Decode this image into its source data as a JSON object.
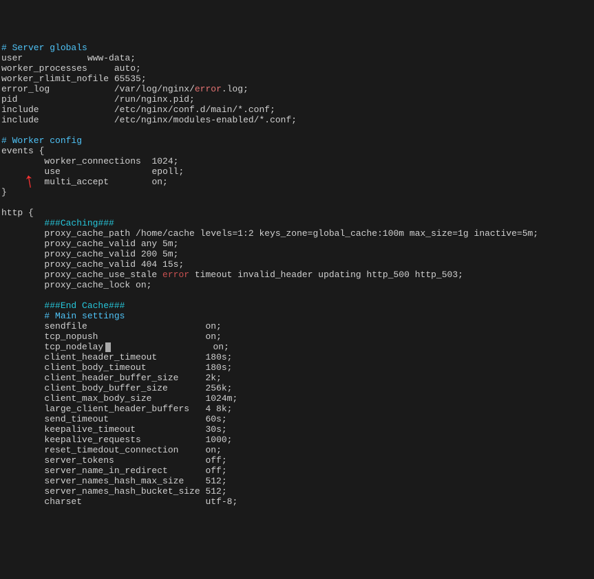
{
  "comments": {
    "server_globals": "# Server globals",
    "worker_config": "# Worker config",
    "caching_start": "###Caching###",
    "caching_end": "###End Cache###",
    "main_settings": "# Main settings"
  },
  "keywords": {
    "error1": "error",
    "error2": "error"
  },
  "globals": [
    {
      "key": "user",
      "pad": "           ",
      "value": " www-data;"
    },
    {
      "key": "worker_processes",
      "pad": "    ",
      "value": " auto;"
    },
    {
      "key": "worker_rlimit_nofile",
      "pad": "",
      "value": " 65535;"
    }
  ],
  "error_log": {
    "key": "error_log",
    "pad": "           ",
    "path_prefix": " /var/log/nginx/",
    "path_suffix": ".log;"
  },
  "globals2": [
    {
      "key": "pid",
      "pad": "                 ",
      "value": " /run/nginx.pid;"
    },
    {
      "key": "include",
      "pad": "             ",
      "value": " /etc/nginx/conf.d/main/*.conf;"
    },
    {
      "key": "include",
      "pad": "             ",
      "value": " /etc/nginx/modules-enabled/*.conf;"
    }
  ],
  "events_open": "events {",
  "events": [
    {
      "key": "        worker_connections",
      "pad": "",
      "value": "  1024;"
    },
    {
      "key": "        use",
      "pad": "               ",
      "value": "  epoll;"
    },
    {
      "key": "        multi_accept",
      "pad": "      ",
      "value": "  on;"
    }
  ],
  "events_close": "}",
  "http_open": "http {",
  "caching": {
    "proxy_cache_path": "        proxy_cache_path /home/cache levels=1:2 keys_zone=global_cache:100m max_size=1g inactive=5m;",
    "proxy_cache_valid_any": "        proxy_cache_valid any 5m;",
    "proxy_cache_valid_200": "        proxy_cache_valid 200 5m;",
    "proxy_cache_valid_404": "        proxy_cache_valid 404 15s;",
    "proxy_cache_use_stale_prefix": "        proxy_cache_use_stale ",
    "proxy_cache_use_stale_suffix": " timeout invalid_header updating http_500 http_503;",
    "proxy_cache_lock": "        proxy_cache_lock on;"
  },
  "main": [
    {
      "k": "        sendfile",
      "p": "                     ",
      "v": " on;"
    },
    {
      "k": "        tcp_nopush",
      "p": "                   ",
      "v": " on;"
    }
  ],
  "tcp_nodelay": {
    "k": "        tcp_nodelay",
    "p": "                  ",
    "v": " on;"
  },
  "main2": [
    {
      "k": "        client_header_timeout",
      "p": "        ",
      "v": " 180s;"
    },
    {
      "k": "        client_body_timeout",
      "p": "          ",
      "v": " 180s;"
    },
    {
      "k": "        client_header_buffer_size",
      "p": "    ",
      "v": " 2k;"
    },
    {
      "k": "        client_body_buffer_size",
      "p": "      ",
      "v": " 256k;"
    },
    {
      "k": "        client_max_body_size",
      "p": "         ",
      "v": " 1024m;"
    },
    {
      "k": "        large_client_header_buffers",
      "p": "  ",
      "v": " 4 8k;"
    },
    {
      "k": "        send_timeout",
      "p": "                 ",
      "v": " 60s;"
    },
    {
      "k": "        keepalive_timeout",
      "p": "            ",
      "v": " 30s;"
    },
    {
      "k": "        keepalive_requests",
      "p": "           ",
      "v": " 1000;"
    },
    {
      "k": "        reset_timedout_connection",
      "p": "    ",
      "v": " on;"
    },
    {
      "k": "        server_tokens",
      "p": "                ",
      "v": " off;"
    },
    {
      "k": "        server_name_in_redirect",
      "p": "      ",
      "v": " off;"
    },
    {
      "k": "        server_names_hash_max_size",
      "p": "   ",
      "v": " 512;"
    },
    {
      "k": "        server_names_hash_bucket_size",
      "p": "",
      "v": " 512;"
    },
    {
      "k": "        charset",
      "p": "                      ",
      "v": " utf-8;"
    }
  ]
}
